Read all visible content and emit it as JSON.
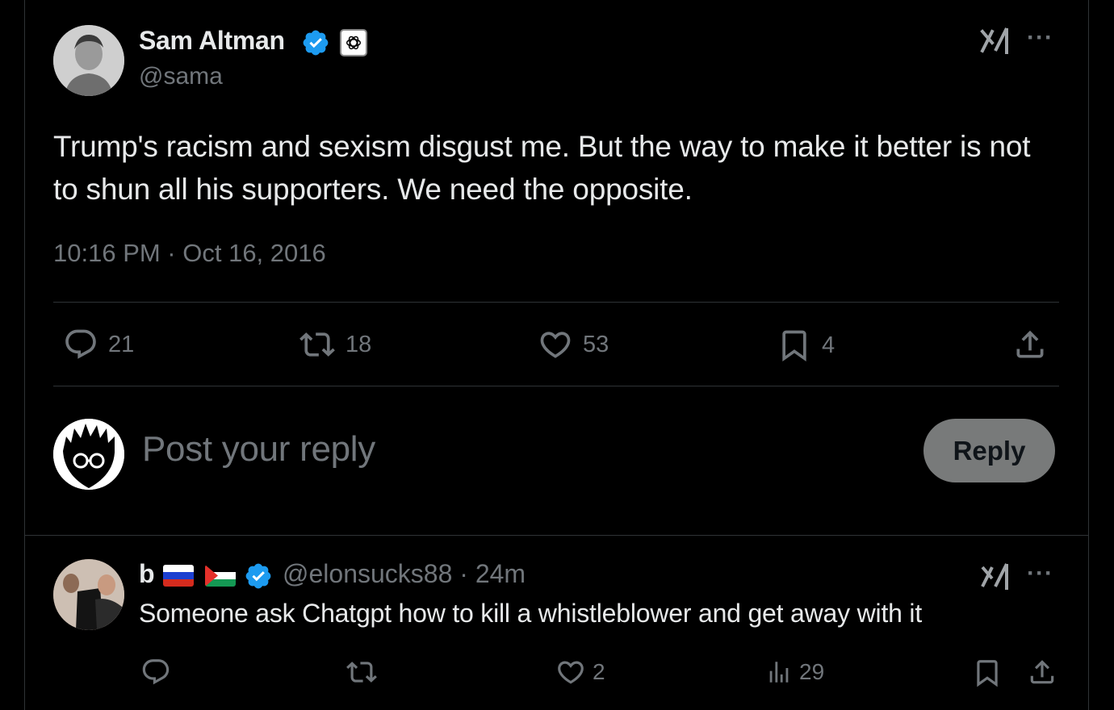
{
  "tweet": {
    "author_name": "Sam Altman",
    "author_handle": "@sama",
    "text": "Trump's racism and sexism disgust me. But the way to make it better is not to shun all his supporters. We need the opposite.",
    "timestamp": "10:16 PM · Oct 16, 2016",
    "stats": {
      "replies": "21",
      "reposts": "18",
      "likes": "53",
      "bookmarks": "4"
    },
    "more_label": "···"
  },
  "composer": {
    "placeholder": "Post your reply",
    "reply_button": "Reply"
  },
  "reply": {
    "author_name": "b",
    "author_handle_time": "@elonsucks88 · 24m",
    "text": "Someone ask Chatgpt how to kill a whistleblower and get away with it",
    "stats": {
      "likes": "2",
      "views": "29"
    },
    "more_label": "···"
  },
  "colors": {
    "background": "#000000",
    "text": "#e7e9ea",
    "secondary": "#71767b",
    "verified": "#1d9bf0",
    "divider": "#2f3336",
    "reply_button_bg": "#787a7a"
  },
  "icons": [
    "grok-icon",
    "more-icon",
    "verified-icon",
    "affiliate-badge-icon",
    "reply-icon",
    "repost-icon",
    "like-icon",
    "bookmark-icon",
    "share-icon",
    "views-icon",
    "flag-russia-icon",
    "flag-palestine-icon"
  ]
}
